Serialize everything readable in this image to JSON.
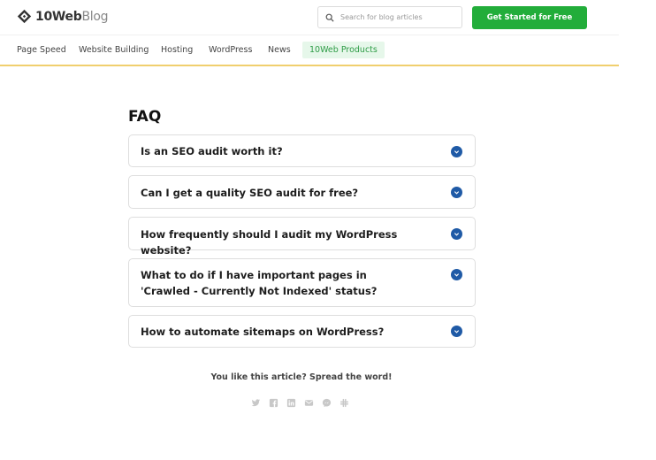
{
  "header": {
    "logo_brand": "10Web",
    "logo_suffix": "Blog",
    "search_placeholder": "Search for blog articles",
    "cta_label": "Get Started for Free"
  },
  "nav": {
    "items": [
      {
        "label": "Page Speed",
        "active": false
      },
      {
        "label": "Website Building",
        "active": false
      },
      {
        "label": "Hosting",
        "active": false
      },
      {
        "label": "WordPress",
        "active": false
      },
      {
        "label": "News",
        "active": false
      },
      {
        "label": "10Web Products",
        "active": true
      }
    ]
  },
  "faq": {
    "title": "FAQ",
    "items": [
      {
        "question": "Is an SEO audit worth it?"
      },
      {
        "question": "Can I get a quality SEO audit for free?"
      },
      {
        "question": "How frequently should I audit my WordPress website?"
      },
      {
        "question": "What to do if I have important pages in 'Crawled - Currently Not Indexed' status?"
      },
      {
        "question": "How to automate sitemaps on WordPress?"
      }
    ]
  },
  "share": {
    "text": "You like this article? Spread the word!",
    "icons": [
      "twitter-icon",
      "facebook-icon",
      "linkedin-icon",
      "email-icon",
      "messenger-icon",
      "slack-icon"
    ]
  },
  "colors": {
    "cta": "#22ad3a",
    "accent_line": "#f0cf6e",
    "chevron": "#1f5aa6",
    "active_nav_bg": "#e6f7ea",
    "active_nav_text": "#2e9c46"
  }
}
